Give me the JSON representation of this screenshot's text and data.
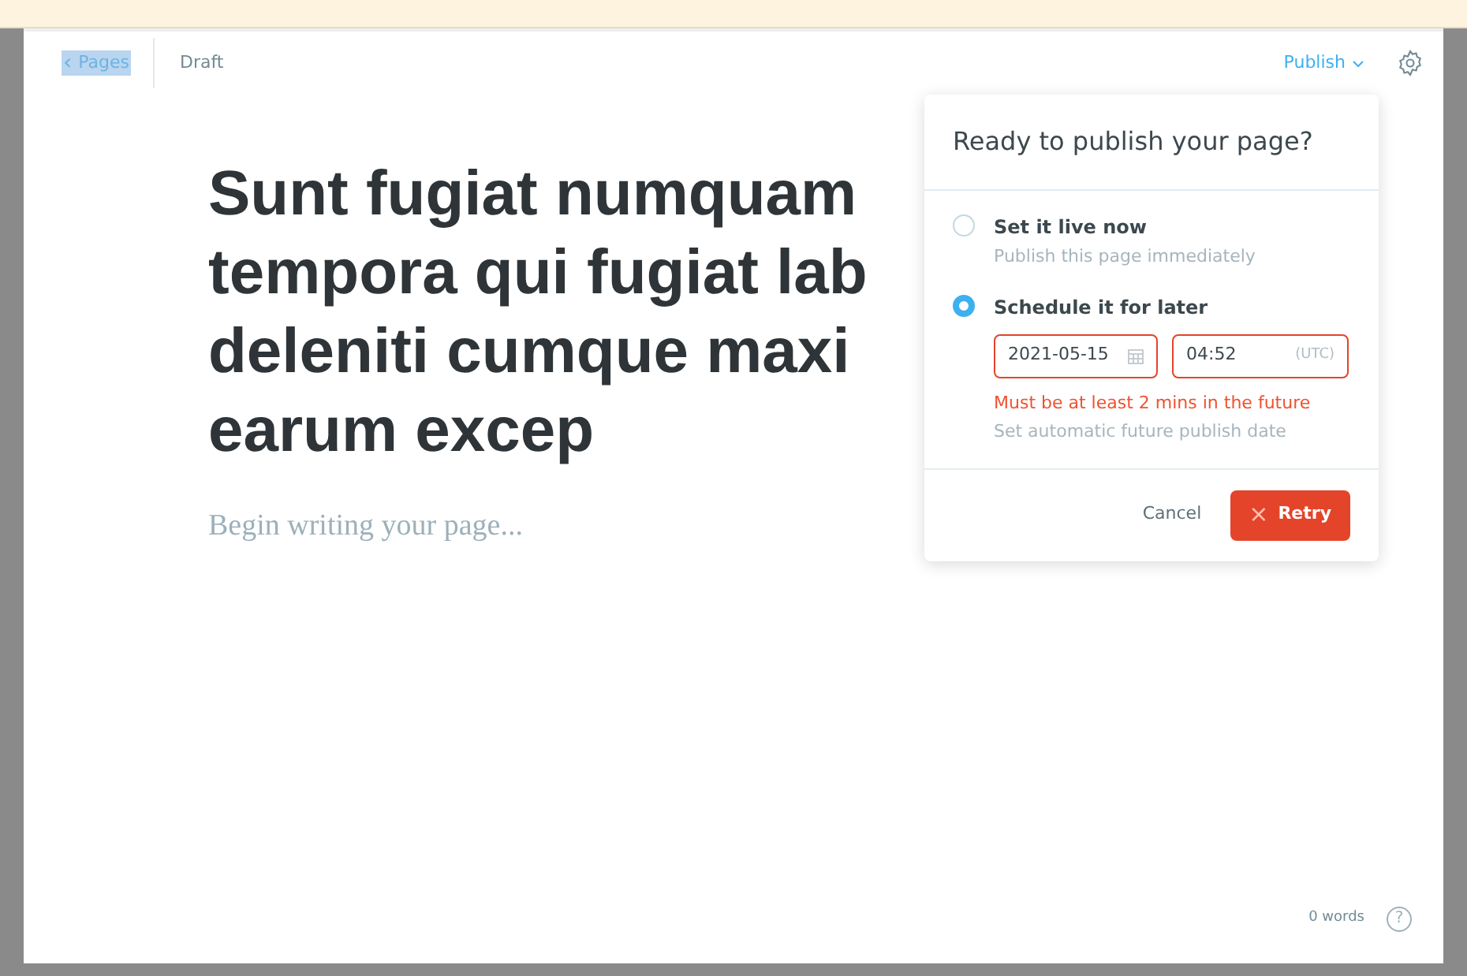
{
  "topbar": {
    "back_link": {
      "icon": "‹",
      "label": "Pages",
      "highlighted": true
    },
    "status": "Draft",
    "publish_menu": "Publish"
  },
  "editor": {
    "title_lines": [
      "Sunt fugiat numquam",
      "tempora qui fugiat lab",
      "deleniti cumque maxi",
      "earum excep"
    ],
    "body_placeholder": "Begin writing your page..."
  },
  "publish_popup": {
    "title": "Ready to publish your page?",
    "options": [
      {
        "label": "Set it live now",
        "description": "Publish this page immediately",
        "selected": false
      },
      {
        "label": "Schedule it for later",
        "selected": true,
        "date": "2021-05-15",
        "time": "04:52",
        "timezone": "(UTC)",
        "error": "Must be at least 2 mins in the future",
        "description": "Set automatic future publish date"
      }
    ],
    "cancel": "Cancel",
    "retry_icon": "×",
    "retry": "Retry"
  },
  "footer": {
    "word_count": "0 words",
    "help": "?"
  }
}
